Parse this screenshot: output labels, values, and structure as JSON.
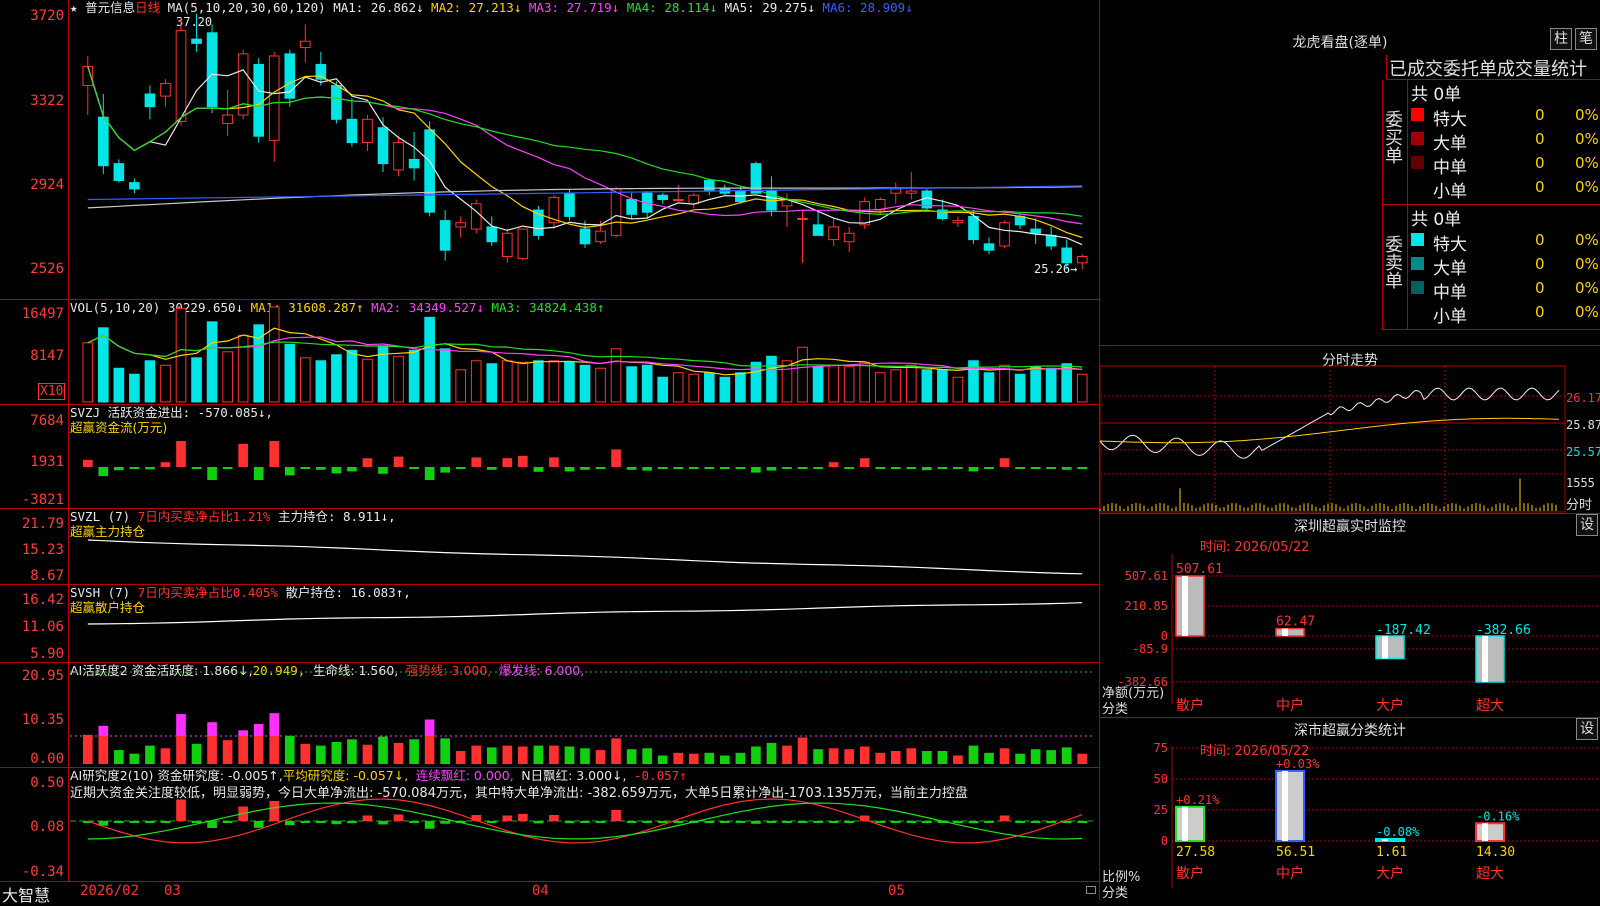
{
  "header": {
    "stock_name": "普元信息",
    "period": "日线",
    "ma_label": "MA(5,10,20,30,60,120)",
    "ma1": "MA1: 26.862↓",
    "ma2": "MA2: 27.213↓",
    "ma3": "MA3: 27.719↓",
    "ma4": "MA4: 28.114↓",
    "ma5": "MA5: 29.275↓",
    "ma6": "MA6: 28.909↓",
    "max_label": "37.20",
    "min_label": "25.26→"
  },
  "colors": {
    "up": "#ff3030",
    "down": "#00e5e5",
    "bg": "#000000",
    "grid": "#b40000"
  },
  "kline_axis": {
    "ticks": [
      "3720",
      "3322",
      "2924",
      "2526"
    ]
  },
  "vol": {
    "label": "VOL(5,10,20)",
    "value": "30229.650↓",
    "ma1": "MA1: 31608.287↑",
    "ma2": "MA2: 34349.527↓",
    "ma3": "MA3: 34824.438↑",
    "ticks": [
      "16497",
      "8147"
    ],
    "unit": "X10"
  },
  "svzj": {
    "label": "SVZJ  活跃资金进出: -570.085↓,",
    "sub": "超赢资金流(万元)",
    "ticks": [
      "7684",
      "1931",
      "-3821"
    ]
  },
  "svzl": {
    "label": "SVZL (7)",
    "sub": "超赢主力持仓",
    "t1": "7日内买卖净占比1.21%",
    "t2": "主力持仓: 8.911↓,",
    "ticks": [
      "21.79",
      "15.23",
      "8.67"
    ]
  },
  "svsh": {
    "label": "SVSH (7)",
    "sub": "超赢散户持仓",
    "t1": "7日内买卖净占比0.405%",
    "t2": "散户持仓: 16.083↑,",
    "ticks": [
      "16.42",
      "11.06",
      "5.90"
    ]
  },
  "ai1": {
    "label": "AI活跃度2 资金活跃度: 1.866↓,",
    "v2": "20.949,",
    "v3": "生命线: 1.560,",
    "v4": "强势线: 3.000,",
    "v5": "爆发线: 6.000,",
    "ticks": [
      "20.95",
      "10.35",
      "0.00"
    ]
  },
  "ai2": {
    "label": "AI研究度2(10) 资金研究度: -0.005↑,",
    "v2": "平均研究度: -0.057↓,",
    "v3": "连续飘红: 0.000,",
    "v4": "N日飘红: 3.000↓,",
    "v5": "-0.057↑",
    "comment": "近期大资金关注度较低，明显弱势，今日大单净流出: -570.084万元，其中特大单净流出: -382.659万元，大单5日累计净出-1703.135万元，当前主力控盘",
    "ticks": [
      "0.50",
      "0.08",
      "-0.34"
    ]
  },
  "xaxis": {
    "brand": "大智慧",
    "labels": [
      "2026/02",
      "03",
      "04",
      "05"
    ]
  },
  "dragon": {
    "title": "龙虎看盘(逐单)",
    "btn1": "柱",
    "btn2": "笔",
    "header": "已成交委托单成交量统计",
    "buy": {
      "side": "委买单",
      "total": "共 0单",
      "rows": [
        {
          "name": "特大",
          "count": "0",
          "pct": "0%",
          "color": "#ff0000"
        },
        {
          "name": "大单",
          "count": "0",
          "pct": "0%",
          "color": "#a00000"
        },
        {
          "name": "中单",
          "count": "0",
          "pct": "0%",
          "color": "#600000"
        },
        {
          "name": "小单",
          "count": "0",
          "pct": "0%",
          "color": "#000000"
        }
      ]
    },
    "sell": {
      "side": "委卖单",
      "total": "共 0单",
      "rows": [
        {
          "name": "特大",
          "count": "0",
          "pct": "0%",
          "color": "#00e5e5"
        },
        {
          "name": "大单",
          "count": "0",
          "pct": "0%",
          "color": "#008a8a"
        },
        {
          "name": "中单",
          "count": "0",
          "pct": "0%",
          "color": "#006060"
        },
        {
          "name": "小单",
          "count": "0",
          "pct": "0%",
          "color": "#000000"
        }
      ]
    }
  },
  "intraday": {
    "title": "分时走势",
    "prices": [
      "26.17",
      "25.87",
      "25.57"
    ],
    "vol_label": "1555",
    "vol_unit": "分时"
  },
  "monitor": {
    "title": "深圳超赢实时监控",
    "btn": "设",
    "time": "时间: 2026/05/22",
    "ylab": "净额(万元)",
    "xlab": "分类",
    "ticks": [
      "507.61",
      "210.85",
      "0",
      "-85.9",
      "-382.66"
    ],
    "bars": [
      {
        "cat": "散户",
        "value": 507.61,
        "label": "507.61"
      },
      {
        "cat": "中户",
        "value": 62.47,
        "label": "62.47"
      },
      {
        "cat": "大户",
        "value": -187.42,
        "label": "-187.42"
      },
      {
        "cat": "超大",
        "value": -382.66,
        "label": "-382.66"
      }
    ]
  },
  "classify": {
    "title": "深市超赢分类统计",
    "btn": "设",
    "time": "时间: 2026/05/22",
    "ylab": "比例%",
    "xlab": "分类",
    "ticks": [
      "75",
      "50",
      "25",
      "0"
    ],
    "bars": [
      {
        "cat": "散户",
        "value": 27.58,
        "label": "27.58",
        "change": "+0.21%"
      },
      {
        "cat": "中户",
        "value": 56.51,
        "label": "56.51",
        "change": "+0.03%"
      },
      {
        "cat": "大户",
        "value": 1.61,
        "label": "1.61",
        "change": "-0.08%"
      },
      {
        "cat": "超大",
        "value": 14.3,
        "label": "14.30",
        "change": "-0.16%"
      }
    ]
  },
  "chart_data": [
    {
      "type": "candlestick",
      "title": "普元信息 日线",
      "note": "approx OHLC read from chart, ~66 sessions 2026/02–2026/05",
      "ohlc": [
        [
          34.0,
          35.4,
          32.6,
          34.9
        ],
        [
          32.5,
          33.6,
          29.8,
          30.2
        ],
        [
          30.3,
          30.5,
          29.4,
          29.5
        ],
        [
          29.4,
          29.6,
          28.9,
          29.1
        ],
        [
          33.6,
          34.0,
          32.4,
          33.0
        ],
        [
          33.5,
          34.3,
          33.0,
          34.1
        ],
        [
          32.3,
          37.2,
          32.1,
          36.6
        ],
        [
          36.2,
          37.4,
          35.6,
          36.0
        ],
        [
          36.5,
          36.9,
          32.7,
          33.0
        ],
        [
          32.2,
          33.8,
          31.6,
          32.6
        ],
        [
          32.6,
          35.7,
          32.4,
          35.5
        ],
        [
          35.0,
          35.3,
          31.3,
          31.6
        ],
        [
          31.4,
          35.6,
          30.4,
          35.4
        ],
        [
          35.5,
          35.7,
          33.0,
          33.4
        ],
        [
          35.8,
          36.9,
          35.1,
          36.1
        ],
        [
          35.0,
          35.6,
          34.0,
          34.3
        ],
        [
          34.0,
          34.2,
          32.2,
          32.4
        ],
        [
          32.4,
          33.4,
          31.1,
          31.3
        ],
        [
          31.3,
          32.6,
          30.9,
          32.4
        ],
        [
          32.0,
          32.5,
          29.9,
          30.3
        ],
        [
          30.0,
          31.6,
          29.7,
          31.3
        ],
        [
          30.5,
          31.8,
          29.5,
          30.1
        ],
        [
          31.9,
          32.3,
          27.8,
          28.0
        ],
        [
          27.6,
          28.1,
          25.7,
          26.2
        ],
        [
          27.3,
          27.8,
          26.8,
          27.5
        ],
        [
          27.2,
          28.6,
          27.0,
          28.4
        ],
        [
          27.3,
          27.8,
          26.4,
          26.6
        ],
        [
          25.9,
          27.2,
          25.6,
          27.0
        ],
        [
          25.8,
          27.2,
          25.7,
          27.2
        ],
        [
          28.1,
          28.3,
          26.7,
          26.9
        ],
        [
          27.5,
          28.8,
          27.2,
          28.7
        ],
        [
          28.9,
          29.1,
          27.6,
          27.8
        ],
        [
          27.2,
          27.6,
          26.3,
          26.5
        ],
        [
          26.6,
          27.6,
          26.5,
          27.1
        ],
        [
          26.9,
          29.2,
          26.8,
          29.1
        ],
        [
          28.6,
          28.9,
          27.7,
          27.9
        ],
        [
          28.9,
          29.0,
          27.7,
          28.0
        ],
        [
          28.8,
          28.9,
          28.4,
          28.6
        ],
        [
          28.6,
          29.3,
          28.5,
          28.6
        ],
        [
          28.4,
          28.9,
          28.2,
          28.8
        ],
        [
          29.5,
          29.6,
          28.8,
          29.0
        ],
        [
          29.1,
          29.3,
          28.8,
          28.9
        ],
        [
          29.0,
          29.2,
          28.4,
          28.5
        ],
        [
          30.3,
          30.4,
          28.9,
          28.9
        ],
        [
          29.0,
          29.7,
          27.8,
          28.1
        ],
        [
          28.3,
          28.9,
          27.3,
          28.6
        ],
        [
          27.7,
          28.1,
          25.6,
          27.7
        ],
        [
          27.4,
          28.1,
          26.9,
          26.9
        ],
        [
          26.7,
          27.7,
          26.4,
          27.3
        ],
        [
          26.6,
          27.3,
          26.1,
          27.0
        ],
        [
          27.4,
          28.7,
          27.2,
          28.5
        ],
        [
          28.1,
          28.7,
          27.9,
          28.6
        ],
        [
          28.9,
          29.4,
          28.4,
          29.1
        ],
        [
          28.9,
          29.9,
          28.6,
          29.0
        ],
        [
          29.0,
          29.1,
          28.1,
          28.2
        ],
        [
          28.1,
          28.6,
          27.6,
          27.7
        ],
        [
          27.5,
          27.8,
          27.3,
          27.6
        ],
        [
          27.8,
          28.1,
          26.5,
          26.7
        ],
        [
          26.5,
          26.8,
          26.0,
          26.2
        ],
        [
          26.4,
          27.6,
          26.3,
          27.5
        ],
        [
          27.8,
          27.9,
          27.2,
          27.4
        ],
        [
          27.2,
          27.7,
          26.5,
          27.0
        ],
        [
          26.9,
          27.3,
          26.2,
          26.4
        ],
        [
          26.3,
          26.7,
          25.3,
          25.6
        ],
        [
          25.6,
          26.0,
          25.3,
          25.9
        ]
      ],
      "ylim": [
        25.26,
        37.2
      ]
    },
    {
      "type": "bar",
      "title": "深圳超赢实时监控",
      "categories": [
        "散户",
        "中户",
        "大户",
        "超大"
      ],
      "values": [
        507.61,
        62.47,
        -187.42,
        -382.66
      ],
      "ylabel": "净额(万元)"
    },
    {
      "type": "bar",
      "title": "深市超赢分类统计",
      "categories": [
        "散户",
        "中户",
        "大户",
        "超大"
      ],
      "values": [
        27.58,
        56.51,
        1.61,
        14.3
      ],
      "ylabel": "比例%"
    }
  ]
}
